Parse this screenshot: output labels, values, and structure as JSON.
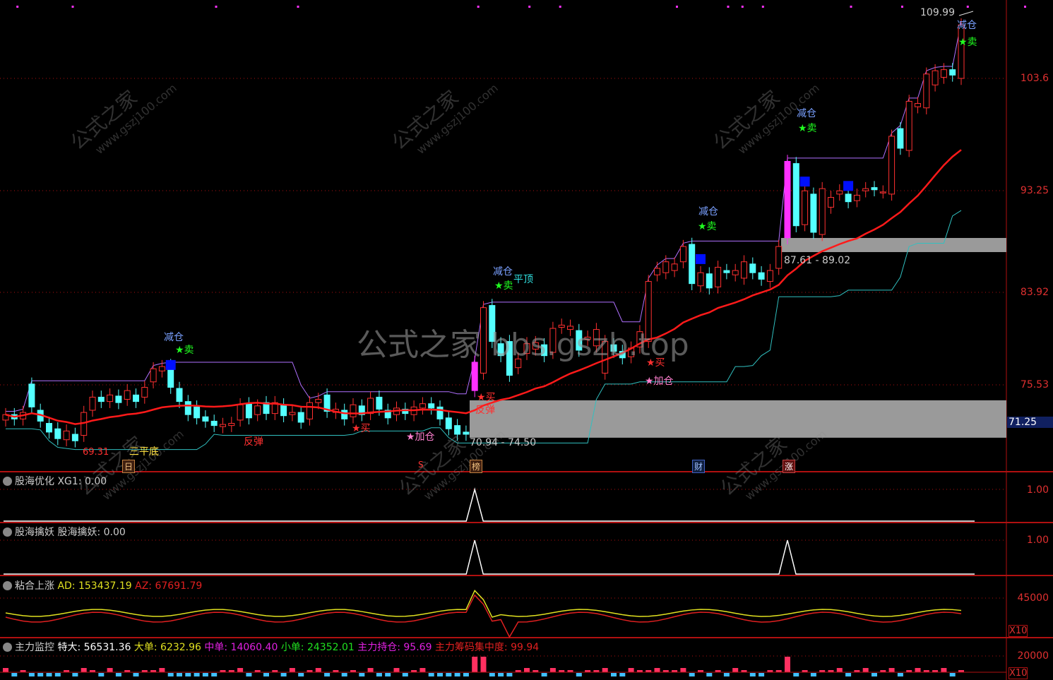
{
  "chart_data": {
    "type": "candlestick",
    "price_axis": {
      "ticks": [
        "109.99",
        "103.6",
        "93.25",
        "83.92",
        "75.53",
        "71.25"
      ],
      "high_label": "109.99",
      "current_label": "71.25"
    },
    "ohlc_note": "open/close pairs per bar",
    "candles": [
      [
        72.3,
        72.8
      ],
      [
        72.8,
        72.4
      ],
      [
        72.4,
        73.0
      ],
      [
        75.6,
        73.5
      ],
      [
        73.2,
        72.2
      ],
      [
        72.0,
        71.2
      ],
      [
        71.5,
        70.6
      ],
      [
        70.5,
        71.3
      ],
      [
        71.0,
        70.4
      ],
      [
        70.9,
        73.0
      ],
      [
        73.2,
        74.4
      ],
      [
        74.4,
        74.0
      ],
      [
        74.0,
        74.6
      ],
      [
        74.5,
        73.9
      ],
      [
        74.2,
        75.0
      ],
      [
        74.6,
        74.0
      ],
      [
        74.4,
        75.3
      ],
      [
        75.8,
        77.0
      ],
      [
        76.8,
        77.2
      ],
      [
        77.3,
        75.3
      ],
      [
        75.2,
        74.0
      ],
      [
        74.0,
        72.8
      ],
      [
        73.5,
        72.5
      ],
      [
        72.6,
        72.2
      ],
      [
        72.2,
        71.8
      ],
      [
        71.7,
        71.9
      ],
      [
        71.8,
        72.0
      ],
      [
        72.3,
        73.7
      ],
      [
        73.8,
        72.5
      ],
      [
        72.8,
        73.6
      ],
      [
        73.9,
        72.9
      ],
      [
        72.9,
        73.9
      ],
      [
        73.7,
        72.7
      ],
      [
        72.8,
        73.0
      ],
      [
        73.0,
        72.1
      ],
      [
        72.4,
        73.9
      ],
      [
        73.9,
        74.2
      ],
      [
        74.6,
        73.1
      ],
      [
        73.0,
        73.3
      ],
      [
        73.2,
        72.4
      ],
      [
        72.6,
        73.7
      ],
      [
        73.6,
        72.8
      ],
      [
        72.9,
        74.3
      ],
      [
        74.4,
        73.3
      ],
      [
        73.2,
        72.5
      ],
      [
        72.8,
        73.4
      ],
      [
        73.3,
        72.9
      ],
      [
        72.8,
        73.5
      ],
      [
        73.4,
        73.8
      ],
      [
        73.8,
        73.4
      ],
      [
        73.5,
        72.4
      ],
      [
        72.5,
        71.5
      ],
      [
        71.8,
        71.0
      ],
      [
        71.2,
        71.0
      ],
      [
        75.0,
        77.6
      ],
      [
        76.6,
        82.6
      ],
      [
        82.8,
        79.5
      ],
      [
        79.3,
        78.2
      ],
      [
        79.5,
        76.4
      ],
      [
        77.1,
        77.9
      ],
      [
        78.4,
        79.3
      ],
      [
        78.8,
        79.4
      ],
      [
        79.2,
        78.2
      ],
      [
        78.5,
        80.7
      ],
      [
        80.8,
        81.0
      ],
      [
        80.6,
        80.9
      ],
      [
        80.5,
        78.7
      ],
      [
        79.7,
        79.9
      ],
      [
        79.1,
        80.6
      ],
      [
        76.6,
        79.5
      ],
      [
        79.2,
        78.6
      ],
      [
        78.6,
        78.0
      ],
      [
        78.1,
        78.9
      ],
      [
        79.0,
        80.4
      ],
      [
        79.5,
        85.0
      ],
      [
        85.6,
        86.2
      ],
      [
        85.8,
        86.8
      ],
      [
        86.0,
        86.6
      ],
      [
        86.8,
        88.2
      ],
      [
        88.4,
        84.8
      ],
      [
        84.6,
        85.8
      ],
      [
        85.7,
        84.4
      ],
      [
        84.5,
        86.3
      ],
      [
        86.0,
        85.8
      ],
      [
        85.6,
        86.0
      ],
      [
        85.3,
        86.8
      ],
      [
        86.6,
        85.8
      ],
      [
        85.8,
        85.2
      ],
      [
        85.0,
        86.0
      ],
      [
        86.2,
        88.2
      ],
      [
        89.0,
        96.0
      ],
      [
        95.8,
        90.1
      ],
      [
        90.2,
        93.3
      ],
      [
        93.0,
        89.5
      ],
      [
        89.3,
        93.5
      ],
      [
        91.8,
        92.7
      ],
      [
        93.0,
        93.3
      ],
      [
        93.0,
        92.3
      ],
      [
        92.4,
        92.9
      ],
      [
        93.3,
        93.5
      ],
      [
        93.6,
        93.4
      ],
      [
        93.2,
        93.2
      ],
      [
        93.0,
        98.3
      ],
      [
        99.0,
        97.2
      ],
      [
        97.0,
        101.5
      ],
      [
        101.0,
        101.3
      ],
      [
        100.9,
        104.0
      ],
      [
        103.0,
        104.3
      ],
      [
        103.7,
        104.4
      ],
      [
        104.4,
        103.9
      ],
      [
        103.6,
        108.5
      ]
    ],
    "limit_up_bars": [
      54,
      90
    ],
    "zones": [
      {
        "label": "70.94 - 74.50",
        "low": 70.94,
        "high": 74.5
      },
      {
        "label": "87.61 - 89.02",
        "low": 87.61,
        "high": 89.02
      }
    ],
    "signal_bars": {
      "xg1": [
        54
      ],
      "qhqy": [
        54,
        90
      ]
    }
  },
  "annotations": {
    "reduce": "减仓",
    "sell": "★卖",
    "buy": "★买",
    "add": "★加仓",
    "rebound": "反弹",
    "flat_top": "平顶",
    "triple_bottom": "三平底",
    "low_label": "69.31"
  },
  "tags": {
    "ri": "日",
    "s": "S",
    "bang": "榜",
    "cai": "财",
    "zhang": "涨"
  },
  "watermarks": {
    "center": "公式之家 bbs.gszb.top",
    "diag_cn": "公式之家",
    "diag_url": "www.gszj100.com"
  },
  "panels": {
    "p1": {
      "name": "股海优化",
      "k": "XG1",
      "v": ": 0.00",
      "tick": "1.00"
    },
    "p2": {
      "name": "股海擒妖",
      "k": "股海擒妖",
      "v": ": 0.00",
      "tick": "1.00"
    },
    "p3": {
      "name": "粘合上涨",
      "ad": "AD: 153437.19",
      "az": "AZ: 67691.79",
      "tick": "45000",
      "mult": "X10"
    },
    "p4": {
      "name": "主力监控",
      "tedai": "特大: 56531.36",
      "dadan": "大单: 6232.96",
      "zhongdan": "中单: 14060.40",
      "xiaodan": "小单: 24352.01",
      "chicang": "主力持仓: 95.69",
      "jizhong": "主力筹码集中度: 99.94",
      "tick": "20000",
      "mult": "X10"
    }
  },
  "colors": {
    "up": "#ff3030",
    "down": "#54ffff",
    "ma": "#ff1a1a",
    "limit": "#ff30ff",
    "zone": "#9a9a9a",
    "grid": "#b01010"
  }
}
